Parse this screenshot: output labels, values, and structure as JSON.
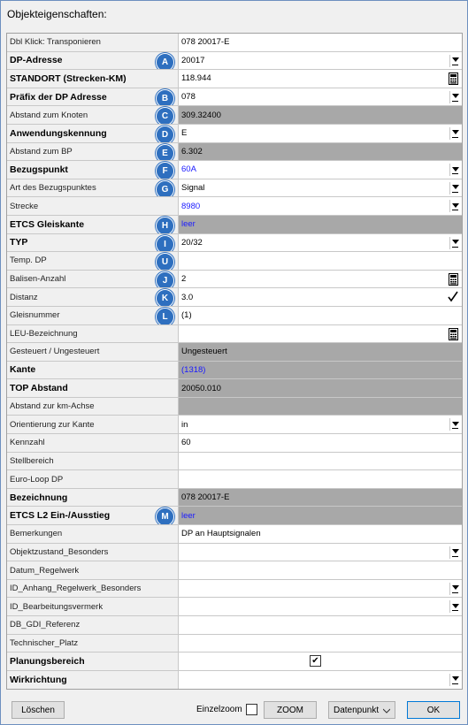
{
  "window": {
    "title": "Objekteigenschaften:"
  },
  "rows": [
    {
      "label": "Dbl Klick: Transponieren",
      "bold": false,
      "value": "078 20017-E",
      "badge": "",
      "bg": "white",
      "blue": false,
      "control": "none"
    },
    {
      "label": "DP-Adresse",
      "bold": true,
      "value": "20017",
      "badge": "A",
      "bg": "white",
      "blue": false,
      "control": "dropdown"
    },
    {
      "label": "STANDORT (Strecken-KM)",
      "bold": true,
      "value": "118.944",
      "badge": "",
      "bg": "white",
      "blue": false,
      "control": "calculator"
    },
    {
      "label": "Präfix der DP Adresse",
      "bold": true,
      "value": "078",
      "badge": "B",
      "bg": "white",
      "blue": false,
      "control": "dropdown"
    },
    {
      "label": "Abstand zum Knoten",
      "bold": false,
      "value": "309.32400",
      "badge": "C",
      "bg": "gray",
      "blue": false,
      "control": "none"
    },
    {
      "label": "Anwendungskennung",
      "bold": true,
      "value": "E",
      "badge": "D",
      "bg": "white",
      "blue": false,
      "control": "dropdown"
    },
    {
      "label": "Abstand zum BP",
      "bold": false,
      "value": "6.302",
      "badge": "E",
      "bg": "gray",
      "blue": false,
      "control": "none"
    },
    {
      "label": "Bezugspunkt",
      "bold": true,
      "value": "60A",
      "badge": "F",
      "bg": "white",
      "blue": true,
      "control": "dropdown"
    },
    {
      "label": "Art des Bezugspunktes",
      "bold": false,
      "value": "Signal",
      "badge": "G",
      "bg": "white",
      "blue": false,
      "control": "dropdown"
    },
    {
      "label": "Strecke",
      "bold": false,
      "value": "8980",
      "badge": "",
      "bg": "white",
      "blue": true,
      "control": "dropdown"
    },
    {
      "label": "ETCS Gleiskante",
      "bold": true,
      "value": "leer",
      "badge": "H",
      "bg": "gray",
      "blue": true,
      "control": "none"
    },
    {
      "label": "TYP",
      "bold": true,
      "value": "20/32",
      "badge": "I",
      "bg": "white",
      "blue": false,
      "control": "dropdown"
    },
    {
      "label": "Temp. DP",
      "bold": false,
      "value": "",
      "badge": "U",
      "bg": "white",
      "blue": false,
      "control": "none"
    },
    {
      "label": "Balisen-Anzahl",
      "bold": false,
      "value": "2",
      "badge": "J",
      "bg": "white",
      "blue": false,
      "control": "calculator"
    },
    {
      "label": "Distanz",
      "bold": false,
      "value": "3.0",
      "badge": "K",
      "bg": "white",
      "blue": false,
      "control": "check"
    },
    {
      "label": "Gleisnummer",
      "bold": false,
      "value": "(1)",
      "badge": "L",
      "bg": "white",
      "blue": false,
      "control": "none"
    },
    {
      "label": "LEU-Bezeichnung",
      "bold": false,
      "value": "",
      "badge": "",
      "bg": "white",
      "blue": false,
      "control": "calculator"
    },
    {
      "label": "Gesteuert / Ungesteuert",
      "bold": false,
      "value": "Ungesteuert",
      "badge": "",
      "bg": "gray",
      "blue": false,
      "control": "none"
    },
    {
      "label": "Kante",
      "bold": true,
      "value": "(1318)",
      "badge": "",
      "bg": "gray",
      "blue": true,
      "control": "none"
    },
    {
      "label": "TOP Abstand",
      "bold": true,
      "value": "20050.010",
      "badge": "",
      "bg": "gray",
      "blue": false,
      "control": "none"
    },
    {
      "label": "Abstand zur km-Achse",
      "bold": false,
      "value": "",
      "badge": "",
      "bg": "gray",
      "blue": false,
      "control": "none"
    },
    {
      "label": "Orientierung zur Kante",
      "bold": false,
      "value": "in",
      "badge": "",
      "bg": "white",
      "blue": false,
      "control": "dropdown"
    },
    {
      "label": "Kennzahl",
      "bold": false,
      "value": "60",
      "badge": "",
      "bg": "white",
      "blue": false,
      "control": "none"
    },
    {
      "label": "Stellbereich",
      "bold": false,
      "value": "",
      "badge": "",
      "bg": "white",
      "blue": false,
      "control": "none"
    },
    {
      "label": "Euro-Loop DP",
      "bold": false,
      "value": "",
      "badge": "",
      "bg": "white",
      "blue": false,
      "control": "none"
    },
    {
      "label": "Bezeichnung",
      "bold": true,
      "value": "078 20017-E",
      "badge": "",
      "bg": "gray",
      "blue": false,
      "control": "none"
    },
    {
      "label": "ETCS L2 Ein-/Ausstieg",
      "bold": true,
      "value": "leer",
      "badge": "M",
      "bg": "gray",
      "blue": true,
      "control": "none"
    },
    {
      "label": "Bemerkungen",
      "bold": false,
      "value": "DP an Hauptsignalen",
      "badge": "",
      "bg": "white",
      "blue": false,
      "control": "none"
    },
    {
      "label": "Objektzustand_Besonders",
      "bold": false,
      "value": "",
      "badge": "",
      "bg": "white",
      "blue": false,
      "control": "dropdown"
    },
    {
      "label": "Datum_Regelwerk",
      "bold": false,
      "value": "",
      "badge": "",
      "bg": "white",
      "blue": false,
      "control": "none"
    },
    {
      "label": "ID_Anhang_Regelwerk_Besonders",
      "bold": false,
      "value": "",
      "badge": "",
      "bg": "white",
      "blue": false,
      "control": "dropdown"
    },
    {
      "label": "ID_Bearbeitungsvermerk",
      "bold": false,
      "value": "",
      "badge": "",
      "bg": "white",
      "blue": false,
      "control": "dropdown"
    },
    {
      "label": "DB_GDI_Referenz",
      "bold": false,
      "value": "",
      "badge": "",
      "bg": "white",
      "blue": false,
      "control": "none"
    },
    {
      "label": "Technischer_Platz",
      "bold": false,
      "value": "",
      "badge": "",
      "bg": "white",
      "blue": false,
      "control": "none"
    },
    {
      "label": "Planungsbereich",
      "bold": true,
      "value": "",
      "badge": "",
      "bg": "white",
      "blue": false,
      "control": "checkbox",
      "checked": true
    },
    {
      "label": "Wirkrichtung",
      "bold": true,
      "value": "",
      "badge": "",
      "bg": "white",
      "blue": false,
      "control": "dropdown"
    }
  ],
  "footer": {
    "delete_label": "Löschen",
    "single_zoom_label": "Einzelzoom",
    "single_zoom_checked": false,
    "zoom_label": "ZOOM",
    "datapoint_select": "Datenpunkt",
    "ok_label": "OK"
  },
  "colors": {
    "badge": "#2e6fbf",
    "gray_cell": "#a8a8a8",
    "link_text": "#1a1aff"
  }
}
